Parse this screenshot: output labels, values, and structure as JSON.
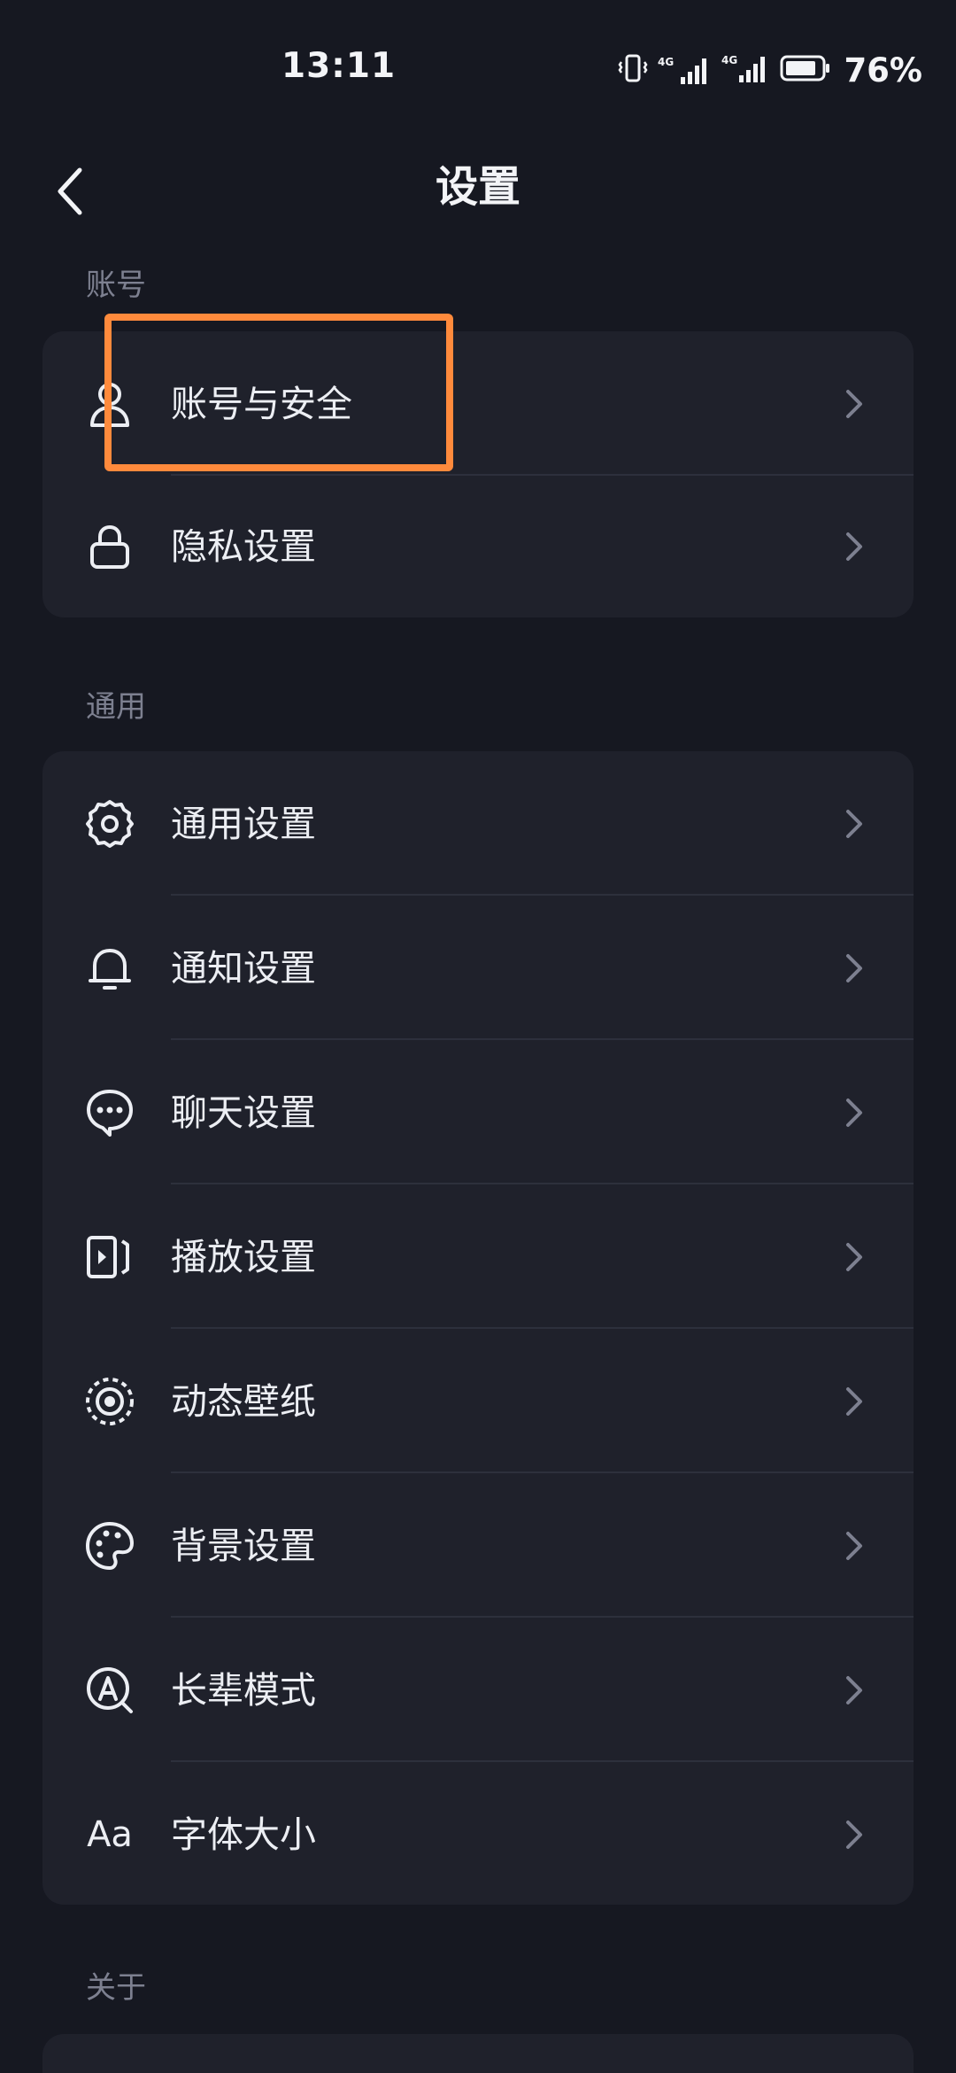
{
  "status_bar": {
    "time": "13:11",
    "network_1": "4G",
    "network_2": "4G",
    "battery_percent": "76%",
    "icons": [
      "vibrate-icon",
      "signal-icon",
      "signal-icon",
      "battery-icon"
    ]
  },
  "header": {
    "title": "设置",
    "back_icon": "chevron-left-icon"
  },
  "sections": {
    "account": {
      "label": "账号",
      "items": [
        {
          "label": "账号与安全",
          "icon": "user-icon"
        },
        {
          "label": "隐私设置",
          "icon": "lock-icon"
        }
      ]
    },
    "general": {
      "label": "通用",
      "items": [
        {
          "label": "通用设置",
          "icon": "gear-icon"
        },
        {
          "label": "通知设置",
          "icon": "bell-icon"
        },
        {
          "label": "聊天设置",
          "icon": "chat-icon"
        },
        {
          "label": "播放设置",
          "icon": "play-icon"
        },
        {
          "label": "动态壁纸",
          "icon": "wallpaper-icon"
        },
        {
          "label": "背景设置",
          "icon": "palette-icon"
        },
        {
          "label": "长辈模式",
          "icon": "elder-mode-icon"
        },
        {
          "label": "字体大小",
          "icon": "font-size-icon",
          "icon_text": "Aa"
        }
      ]
    },
    "about": {
      "label": "关于"
    }
  },
  "colors": {
    "background": "#161821",
    "card": "#1f212b",
    "highlight": "#ff8a3c",
    "muted_text": "#7d8090"
  }
}
